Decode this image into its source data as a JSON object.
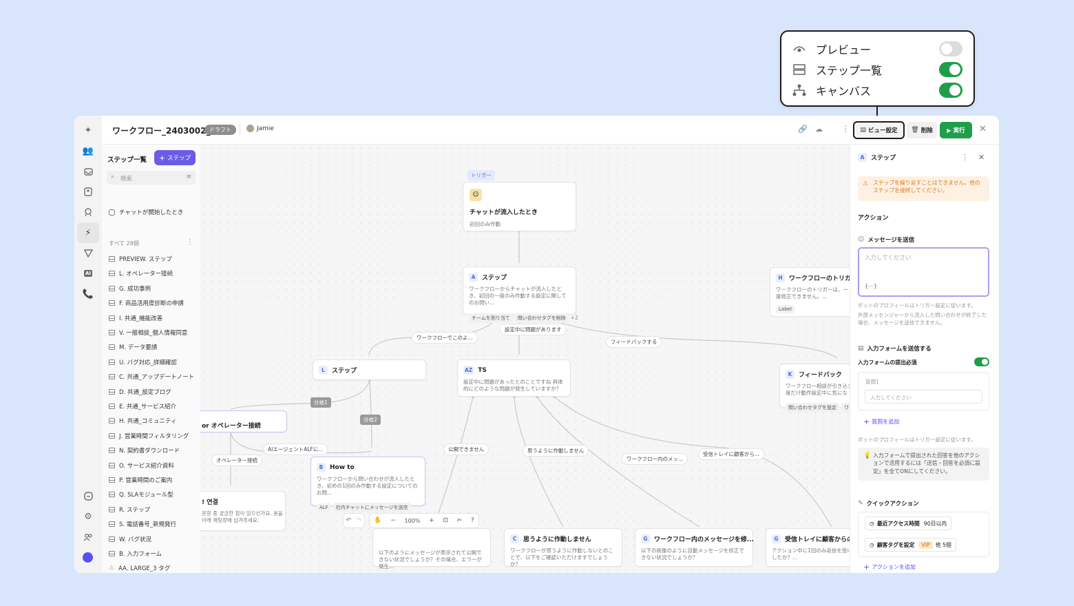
{
  "popover": {
    "rows": [
      {
        "label": "プレビュー",
        "icon": "eye-icon",
        "on": false
      },
      {
        "label": "ステップ一覧",
        "icon": "list-icon",
        "on": true
      },
      {
        "label": "キャンバス",
        "icon": "hierarchy-icon",
        "on": true
      }
    ]
  },
  "header": {
    "title": "ワークフロー_2403002_1",
    "status_badge": "ドラフト",
    "user": "Jamie",
    "view_settings_label": "ビュー設定",
    "delete_label": "削除",
    "run_label": "実行"
  },
  "steplist": {
    "title": "ステップ一覧",
    "add_label": "ステップ",
    "search_placeholder": "検索",
    "trigger_item": "チャットが開始したとき",
    "count_label": "すべて 28個",
    "items": [
      "PREVIEW. ステップ",
      "L. オペレーター接続",
      "G. 成功事例",
      "F. 商品活用度診断の申請",
      "I. 共通_機能改善",
      "V. 一般相談_個人情報同意",
      "M. データ要請",
      "U. バグ対応_詳細確認",
      "C. 共通_アップデートノート",
      "D. 共通_設定ブログ",
      "E. 共通_サービス紹介",
      "H. 共通_コミュニティ",
      "J. 営業時間フィルタリング",
      "N. 契約書ダウンロード",
      "O. サービス紹介資料",
      "P. 営業時間のご案内",
      "Q. SLAモジュール型",
      "R. ステップ",
      "S. 電話番号_新規発行",
      "W. バグ状況",
      "B. 入力フォーム",
      "AA. LARGE_3 タグ"
    ]
  },
  "canvas": {
    "trigger_tag": "トリガー",
    "trigger_title": "チャットが流入したとき",
    "trigger_sub": "初回のみ作動",
    "nodeA": {
      "badge": "A",
      "title": "ステップ",
      "desc": "ワークフローからチャットが流入したとき、初回の一度のみ作動する設定に関してのお問い...",
      "chips": [
        "チームを割り当て",
        "問い合わせタグを削除"
      ],
      "more": "+2"
    },
    "edge_left": "ワークフローでこのよ...",
    "edge_mid": "設定中に問題があります",
    "edge_right": "フィードバックする",
    "nodeL": {
      "badge": "L",
      "title": "ステップ"
    },
    "nodeAZ": {
      "badge": "AZ",
      "title": "TS",
      "desc": "設定中に問題があったとのことですね 具体的にどのような問題が発生していますか？"
    },
    "nodeH": {
      "badge": "H",
      "title": "ワークフローのトリガー",
      "desc": "ワークフローのトリガーは、一度修正できません。...",
      "chip": "Label"
    },
    "nodeK": {
      "badge": "K",
      "title": "フィードバック",
      "desc": "ワークフロー相談が引き込ま一度だけ動作設定中に気にな",
      "chip": "問い合わせタグを設定",
      "chip2": "ワーク"
    },
    "branch1": "分岐1",
    "branch2": "分岐2",
    "node_op": "or オペレーター接続",
    "edge_op": "オペレーター接続",
    "edge_ai": "AIエージェントALFに...",
    "nodeB": {
      "badge": "B",
      "title": "How to",
      "desc": "ワークフローから問い合わせが流入したとき、初めの1回のみ作動する設定についてのお問...",
      "chips": [
        "ALF",
        "社内チャットにメッセージを送信"
      ]
    },
    "node_ko": {
      "title": "! 연결",
      "desc": "문항 중 궁금한 점이 있으신가요. 용을 아래 채팅창에 남겨주세요."
    },
    "edges_ts": [
      "公開できません",
      "思うように作動しません",
      "ワークフロー内のメッ...",
      "受信トレイに顧客から..."
    ],
    "node_pub": {
      "desc": "以下のようにメッセージが表示されて公開できない状況でしょうか？その場合、エラーが発生..."
    },
    "nodeC": {
      "badge": "C",
      "title": "思うように作動しません",
      "desc": "ワークフローが思うように作動しないとのことで、以下をご確認いただけますでしょうか？"
    },
    "nodeG": {
      "badge": "G",
      "title": "ワークフロー内のメッセージを修...",
      "desc": "以下の画像のように自動メッセージを修正できない状況でしょうか？"
    },
    "nodeG2": {
      "badge": "G",
      "title": "受信トレイに顧客からの",
      "desc": "アクション中に1回のみ返信を受けておきましたか？..."
    },
    "zoom": "100%"
  },
  "panel": {
    "badge": "A",
    "title": "ステップ",
    "warning": "ステップを繰り返すことはできません。他のステップを接続してください。",
    "action_heading": "アクション",
    "send_message_label": "メッセージを送信",
    "message_placeholder": "入力してください",
    "var_token": "{⋯}",
    "note1": "ボットのプロフィールはトリガー設定に従います。",
    "note2": "外部メッセンジャーから流入した問い合わせが終了した場合、メッセージを送信できません。",
    "form_label": "入力フォームを送信する",
    "form_required": "入力フォームの提出必須",
    "question_label": "質問1",
    "question_placeholder": "入力してください",
    "add_question": "質問を追加",
    "note3": "ボットのプロフィールはトリガー設定に従います。",
    "tip": "入力フォームで提出された回答を他のアクションで活用するには「送信・回答を必須に設定」を全てONにしてください。",
    "quick_heading": "クイックアクション",
    "quick1_label": "最近アクセス時間",
    "quick1_value": "90日以内",
    "quick2_label": "顧客タグを設定",
    "quick2_tag": "VIP",
    "quick2_more": "他 5個",
    "add_action": "アクションを追加"
  },
  "colors": {
    "accent": "#6b5ce7",
    "run": "#1f9e4a",
    "toggle_on": "#1f9e4a",
    "warning_bg": "#fdf1e3",
    "warning_text": "#e07a1f"
  }
}
